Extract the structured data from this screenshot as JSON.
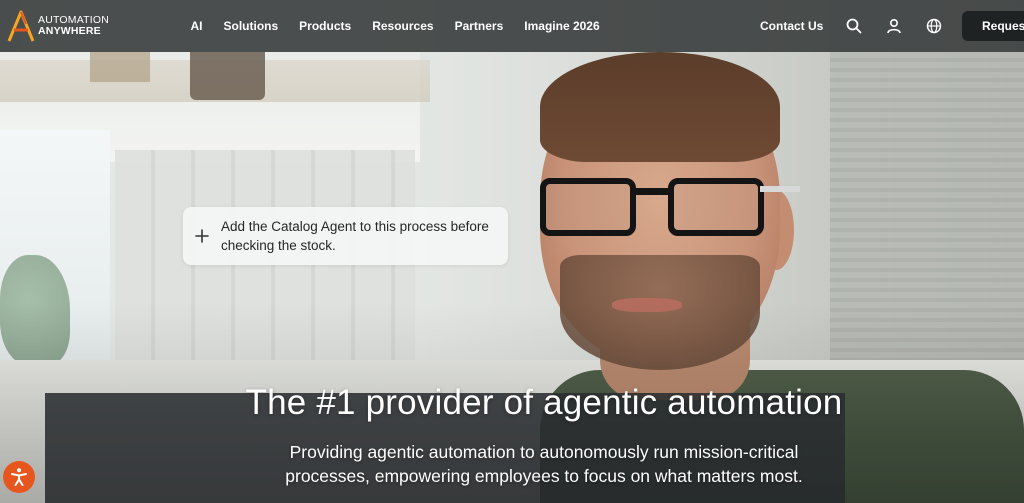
{
  "brand": {
    "line1": "AUTOMATION",
    "line2": "ANYWHERE",
    "accent_colors": [
      "#f5a623",
      "#e8561f"
    ]
  },
  "nav": {
    "items": [
      {
        "label": "AI"
      },
      {
        "label": "Solutions"
      },
      {
        "label": "Products"
      },
      {
        "label": "Resources"
      },
      {
        "label": "Partners"
      },
      {
        "label": "Imagine 2026"
      }
    ],
    "contact_label": "Contact Us",
    "icons": [
      "search-icon",
      "user-icon",
      "globe-icon"
    ],
    "request_label": "Request",
    "background": "#3e4242"
  },
  "hero": {
    "chat_prompt": "Add the Catalog Agent to this process before checking the stock.",
    "headline": "The #1 provider of agentic automation",
    "subhead_line1": "Providing agentic automation to autonomously run mission-critical",
    "subhead_line2": "processes, empowering employees to focus on what matters most."
  },
  "accessibility": {
    "icon": "accessibility-icon",
    "color": "#e8561f"
  }
}
